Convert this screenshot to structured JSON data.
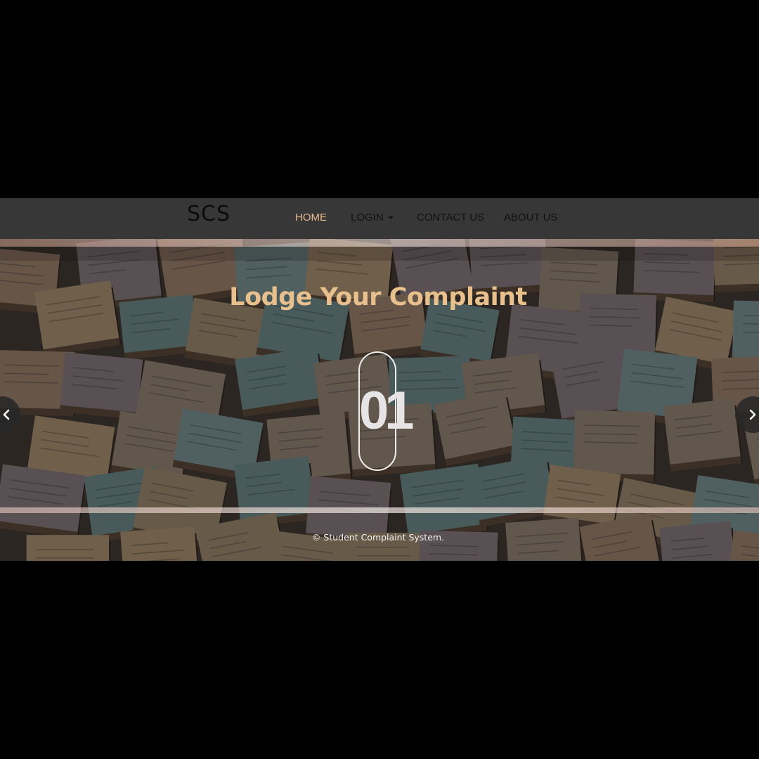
{
  "navbar": {
    "brand": "SCS",
    "items": [
      {
        "label": "HOME",
        "active": true
      },
      {
        "label": "LOGIN",
        "dropdown": true
      },
      {
        "label": "CONTACT US"
      },
      {
        "label": "ABOUT US"
      }
    ],
    "active_color": "#e3b98a",
    "background": "#373737"
  },
  "hero": {
    "title": "Lodge Your Complaint",
    "slide_number": "01",
    "title_color": "#e7c08e",
    "prev_icon": "chevron-left-icon",
    "next_icon": "chevron-right-icon"
  },
  "footer": {
    "copyright": "© Student Complaint System."
  }
}
